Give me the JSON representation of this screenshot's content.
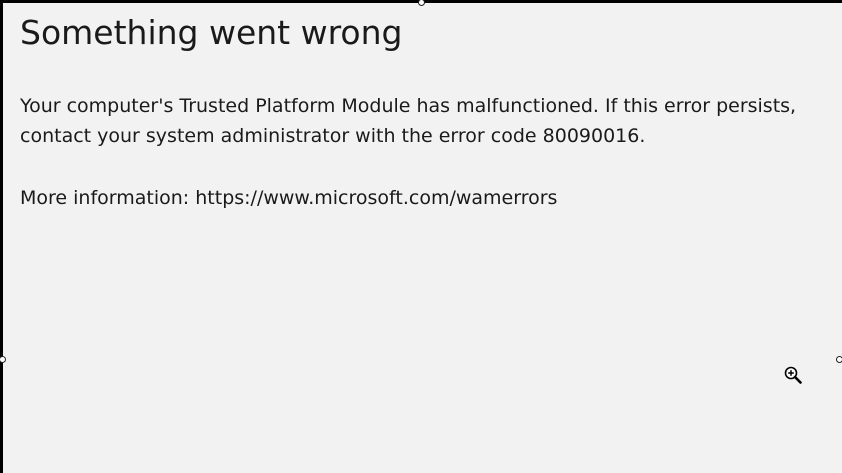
{
  "dialog": {
    "title": "Something went wrong",
    "message_line1": "Your computer's Trusted Platform Module has malfunctioned. If this error persists,",
    "message_line2": "contact your system administrator with the error code 80090016.",
    "more_info_label": "More information:",
    "more_info_url": "https://www.microsoft.com/wamerrors"
  },
  "cursor": {
    "icon": "zoom-in-icon"
  },
  "colors": {
    "background": "#f2f2f2",
    "text": "#1a1a1a",
    "border": "#000000"
  }
}
